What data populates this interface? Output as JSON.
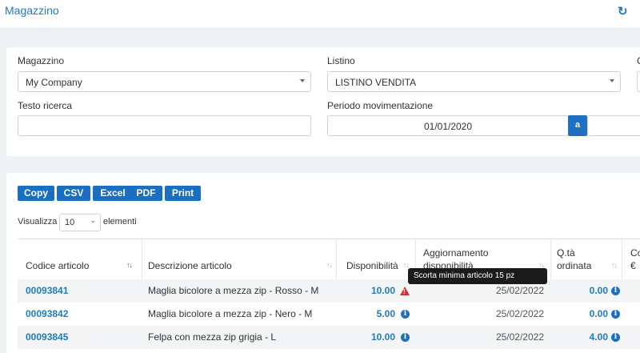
{
  "header": {
    "title": "Magazzino",
    "refresh_icon": "sync-icon"
  },
  "filters": {
    "magazzino_label": "Magazzino",
    "magazzino_value": "My Company",
    "listino_label": "Listino",
    "listino_value": "LISTINO VENDITA",
    "third_label_fragment": "C",
    "testo_label": "Testo ricerca",
    "testo_value": "",
    "periodo_label": "Periodo movimentazione",
    "periodo_from": "01/01/2020",
    "periodo_sep": "a"
  },
  "export_buttons": [
    "Copy",
    "CSV",
    "Excel",
    "PDF",
    "Print"
  ],
  "length": {
    "prefix": "Visualizza",
    "value": "10",
    "suffix": "elementi"
  },
  "table": {
    "columns": [
      "Codice articolo",
      "Descrizione articolo",
      "Disponibilità",
      "Aggiornamento disponibilità",
      "Q.tà ordinata",
      "Co €"
    ],
    "col6_line1": "Co",
    "col6_line2": "€",
    "col4_line1": "Aggiornamento",
    "col4_line2": "disponibilità",
    "col5_line1": "Q.tà",
    "col5_line2": "ordinata",
    "rows": [
      {
        "code": "00093841",
        "desc": "Maglia bicolore a mezza zip - Rosso - M",
        "disp": "10.00",
        "disp_icon": "warning-icon",
        "date": "25/02/2022",
        "qty": "0.00"
      },
      {
        "code": "00093842",
        "desc": "Maglia bicolore a mezza zip - Nero - M",
        "disp": "5.00",
        "disp_icon": "info-icon",
        "date": "25/02/2022",
        "qty": "0.00"
      },
      {
        "code": "00093845",
        "desc": "Felpa con mezza zip grigia - L",
        "disp": "10.00",
        "disp_icon": "info-icon",
        "date": "25/02/2022",
        "qty": "4.00"
      }
    ]
  },
  "tooltip": "Scorta minima articolo 15 pz",
  "colors": {
    "primary": "#1f7bc4",
    "button": "#1a6fc3",
    "warning": "#d0323a"
  }
}
